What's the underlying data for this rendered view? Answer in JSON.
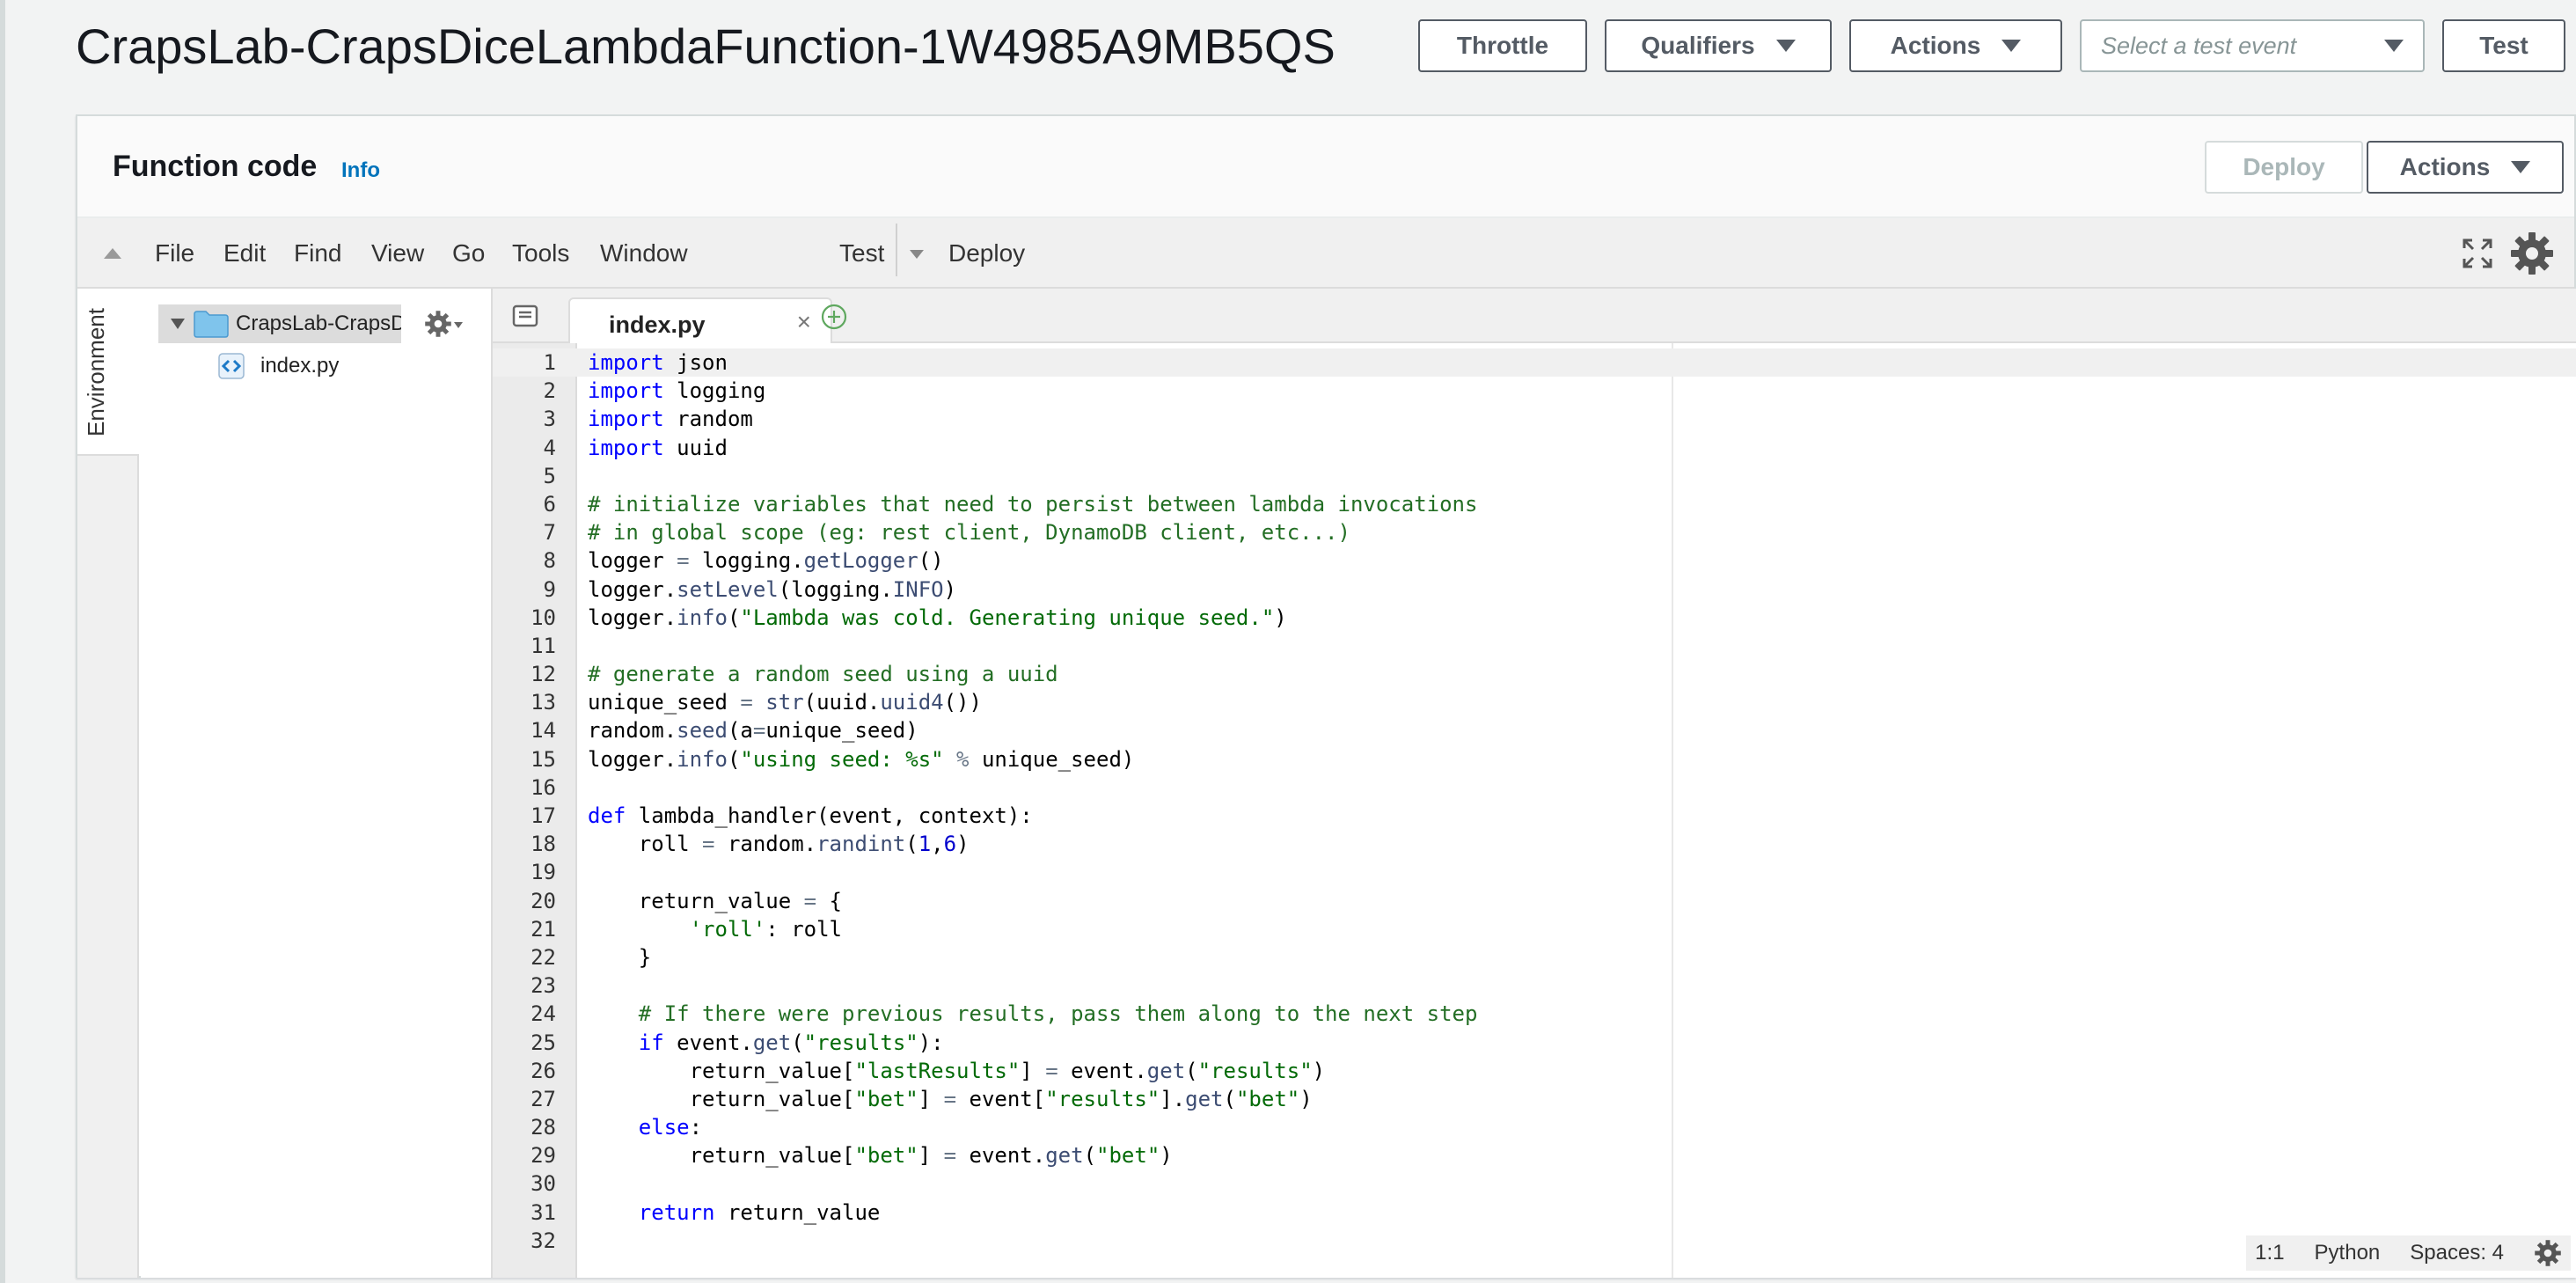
{
  "header": {
    "title": "CrapsLab-CrapsDiceLambdaFunction-1W4985A9MB5QS",
    "throttle_label": "Throttle",
    "qualifiers_label": "Qualifiers",
    "actions_label": "Actions",
    "test_event_placeholder": "Select a test event",
    "test_label": "Test"
  },
  "panel": {
    "title": "Function code",
    "info_link": "Info",
    "deploy_label": "Deploy",
    "actions_label": "Actions"
  },
  "ide": {
    "menu": [
      "File",
      "Edit",
      "Find",
      "View",
      "Go",
      "Tools",
      "Window"
    ],
    "test_label": "Test",
    "deploy_label": "Deploy",
    "environment_tab": "Environment",
    "tree": {
      "root_folder": "CrapsLab-CrapsDice",
      "file": "index.py"
    },
    "tab_label": "index.py",
    "tab_close": "×",
    "status": {
      "position": "1:1",
      "language": "Python",
      "spaces": "Spaces: 4"
    }
  },
  "code_lines": [
    "import json",
    "import logging",
    "import random",
    "import uuid",
    "",
    "# initialize variables that need to persist between lambda invocations",
    "# in global scope (eg: rest client, DynamoDB client, etc...)",
    "logger = logging.getLogger()",
    "logger.setLevel(logging.INFO)",
    "logger.info(\"Lambda was cold. Generating unique seed.\")",
    "",
    "# generate a random seed using a uuid",
    "unique_seed = str(uuid.uuid4())",
    "random.seed(a=unique_seed)",
    "logger.info(\"using seed: %s\" % unique_seed)",
    "",
    "def lambda_handler(event, context):",
    "    roll = random.randint(1,6)",
    "",
    "    return_value = {",
    "        'roll': roll",
    "    }",
    "",
    "    # If there were previous results, pass them along to the next step",
    "    if event.get(\"results\"):",
    "        return_value[\"lastResults\"] = event.get(\"results\")",
    "        return_value[\"bet\"] = event[\"results\"].get(\"bet\")",
    "    else:",
    "        return_value[\"bet\"] = event.get(\"bet\")",
    "",
    "    return return_value",
    ""
  ],
  "colors": {
    "keyword": "#0000ff",
    "comment": "#236e24",
    "string": "#036a07",
    "accent_link": "#0073bb"
  },
  "icons": [
    "collapse-caret-icon",
    "expand-icon",
    "gear-icon",
    "folder-icon",
    "python-file-icon",
    "tab-list-icon",
    "add-tab-icon",
    "close-icon"
  ]
}
